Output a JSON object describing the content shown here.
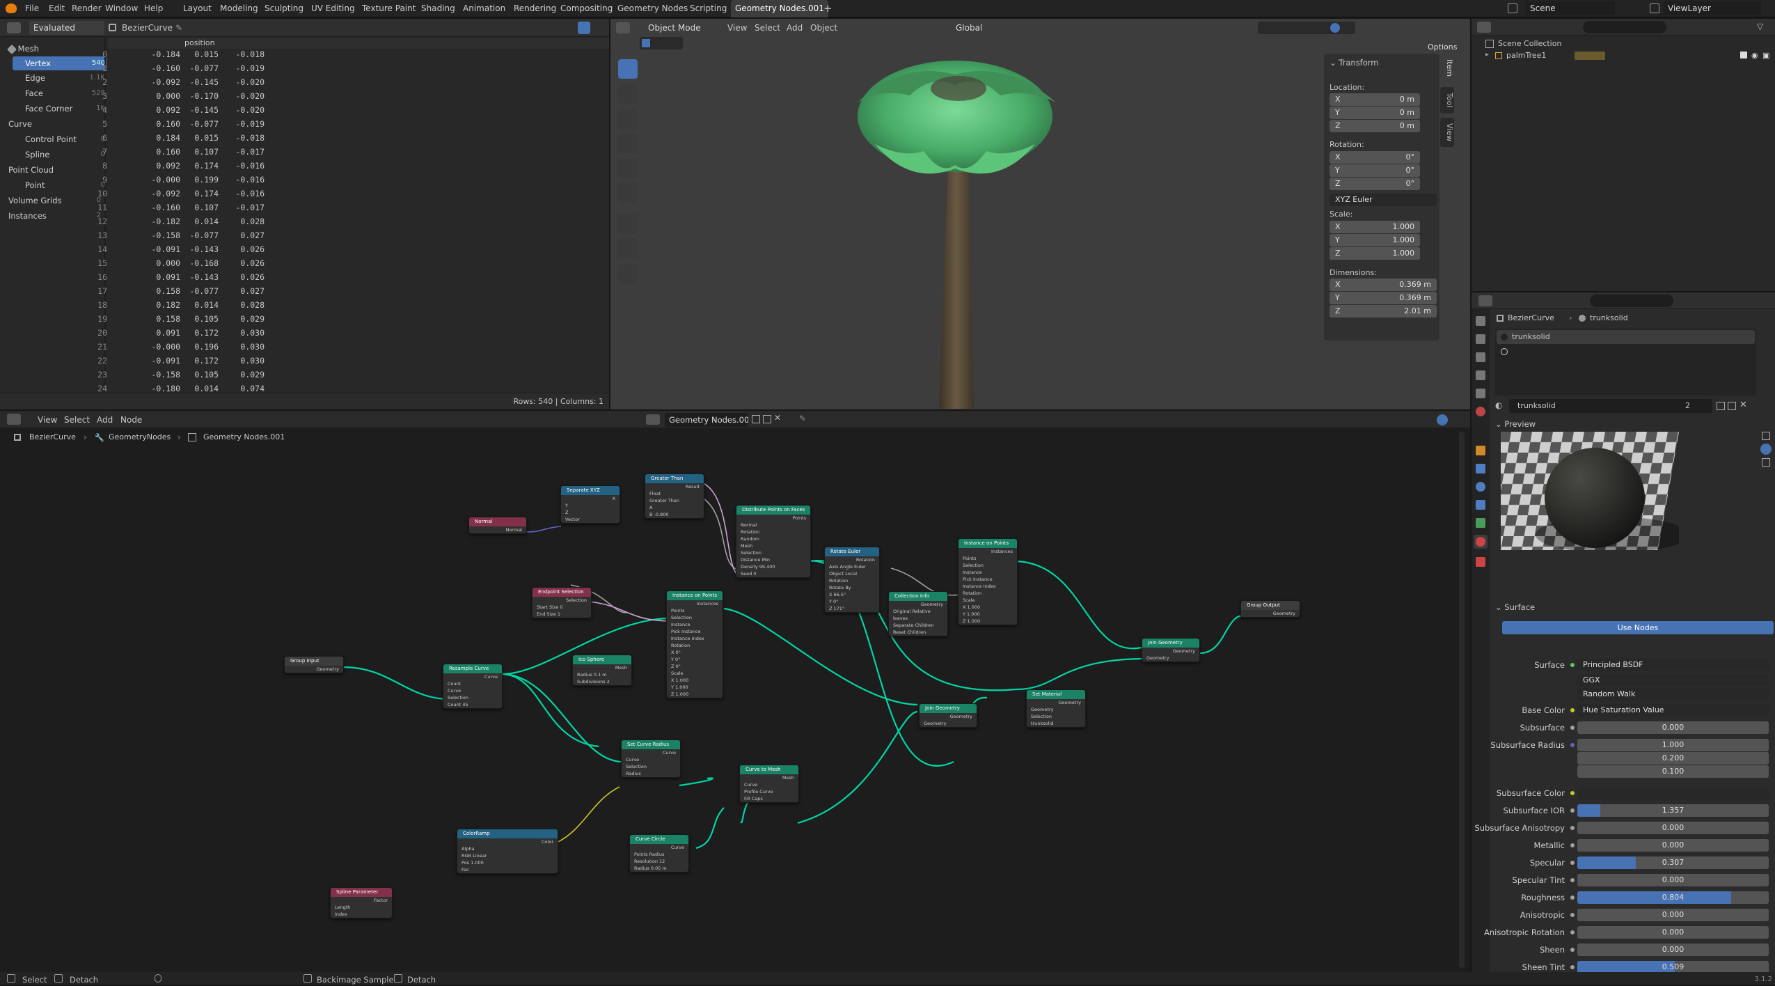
{
  "topbar": {
    "menus": [
      "File",
      "Edit",
      "Render",
      "Window",
      "Help"
    ],
    "workspaces": [
      "Layout",
      "Modeling",
      "Sculpting",
      "UV Editing",
      "Texture Paint",
      "Shading",
      "Animation",
      "Rendering",
      "Compositing",
      "Geometry Nodes",
      "Scripting",
      "Geometry Nodes.001"
    ],
    "scene": "Scene",
    "view_layer": "ViewLayer"
  },
  "spreadsheet": {
    "mode": "Evaluated",
    "object": "BezierCurve",
    "column": "position",
    "tree": [
      {
        "label": "Mesh",
        "count": ""
      },
      {
        "label": "Vertex",
        "count": "540"
      },
      {
        "label": "Edge",
        "count": "1.1K"
      },
      {
        "label": "Face",
        "count": "528"
      },
      {
        "label": "Face Corner",
        "count": "1K"
      },
      {
        "label": "Curve",
        "count": ""
      },
      {
        "label": "Control Point",
        "count": "0"
      },
      {
        "label": "Spline",
        "count": "0"
      },
      {
        "label": "Point Cloud",
        "count": ""
      },
      {
        "label": "Point",
        "count": "0"
      },
      {
        "label": "Volume Grids",
        "count": "0"
      },
      {
        "label": "Instances",
        "count": "2"
      }
    ],
    "rows": [
      [
        "0",
        "-0.184",
        "0.015",
        "-0.018"
      ],
      [
        "1",
        "-0.160",
        "-0.077",
        "-0.019"
      ],
      [
        "2",
        "-0.092",
        "-0.145",
        "-0.020"
      ],
      [
        "3",
        "0.000",
        "-0.170",
        "-0.020"
      ],
      [
        "4",
        "0.092",
        "-0.145",
        "-0.020"
      ],
      [
        "5",
        "0.160",
        "-0.077",
        "-0.019"
      ],
      [
        "6",
        "0.184",
        "0.015",
        "-0.018"
      ],
      [
        "7",
        "0.160",
        "0.107",
        "-0.017"
      ],
      [
        "8",
        "0.092",
        "0.174",
        "-0.016"
      ],
      [
        "9",
        "-0.000",
        "0.199",
        "-0.016"
      ],
      [
        "10",
        "-0.092",
        "0.174",
        "-0.016"
      ],
      [
        "11",
        "-0.160",
        "0.107",
        "-0.017"
      ],
      [
        "12",
        "-0.182",
        "0.014",
        "0.028"
      ],
      [
        "13",
        "-0.158",
        "-0.077",
        "0.027"
      ],
      [
        "14",
        "-0.091",
        "-0.143",
        "0.026"
      ],
      [
        "15",
        "0.000",
        "-0.168",
        "0.026"
      ],
      [
        "16",
        "0.091",
        "-0.143",
        "0.026"
      ],
      [
        "17",
        "0.158",
        "-0.077",
        "0.027"
      ],
      [
        "18",
        "0.182",
        "0.014",
        "0.028"
      ],
      [
        "19",
        "0.158",
        "0.105",
        "0.029"
      ],
      [
        "20",
        "0.091",
        "0.172",
        "0.030"
      ],
      [
        "21",
        "-0.000",
        "0.196",
        "0.030"
      ],
      [
        "22",
        "-0.091",
        "0.172",
        "0.030"
      ],
      [
        "23",
        "-0.158",
        "0.105",
        "0.029"
      ],
      [
        "24",
        "-0.180",
        "0.014",
        "0.074"
      ]
    ],
    "footer": "Rows: 540   |   Columns: 1"
  },
  "viewport": {
    "mode": "Object Mode",
    "menus": [
      "View",
      "Select",
      "Add",
      "Object"
    ],
    "orientation": "Global",
    "options": "Options",
    "tabs": [
      "Item",
      "Tool",
      "View"
    ],
    "transform": {
      "title": "Transform",
      "location_label": "Location:",
      "rotation_label": "Rotation:",
      "scale_label": "Scale:",
      "dimensions_label": "Dimensions:",
      "rot_mode": "XYZ Euler",
      "location": [
        [
          "X",
          "0 m"
        ],
        [
          "Y",
          "0 m"
        ],
        [
          "Z",
          "0 m"
        ]
      ],
      "rotation": [
        [
          "X",
          "0°"
        ],
        [
          "Y",
          "0°"
        ],
        [
          "Z",
          "0°"
        ]
      ],
      "scale": [
        [
          "X",
          "1.000"
        ],
        [
          "Y",
          "1.000"
        ],
        [
          "Z",
          "1.000"
        ]
      ],
      "dimensions": [
        [
          "X",
          "0.369 m"
        ],
        [
          "Y",
          "0.369 m"
        ],
        [
          "Z",
          "2.01 m"
        ]
      ]
    }
  },
  "outliner": {
    "collection": "Scene Collection",
    "object": "palmTree1"
  },
  "node_editor": {
    "menus": [
      "View",
      "Select",
      "Add",
      "Node"
    ],
    "tree_name": "Geometry Nodes.001",
    "breadcrumb": [
      "BezierCurve",
      "GeometryNodes",
      "Geometry Nodes.001"
    ],
    "nodes": [
      {
        "title": "Group Input",
        "rows": [
          "Geometry"
        ]
      },
      {
        "title": "Resample Curve",
        "rows": [
          "Curve",
          "Count",
          "Curve",
          "Selection",
          "Count  45"
        ]
      },
      {
        "title": "Normal",
        "rows": [
          "Normal"
        ]
      },
      {
        "title": "Separate XYZ",
        "rows": [
          "X",
          "Y",
          "Z",
          "Vector"
        ]
      },
      {
        "title": "Greater Than",
        "rows": [
          "Result",
          "Float",
          "Greater Than",
          "A",
          "B  -0.800"
        ]
      },
      {
        "title": "Endpoint Selection",
        "rows": [
          "Selection",
          "Start Size  0",
          "End Size  1"
        ]
      },
      {
        "title": "Ico Sphere",
        "rows": [
          "Mesh",
          "Radius  0.1 m",
          "Subdivisions  2"
        ]
      },
      {
        "title": "Instance on Points",
        "rows": [
          "Instances",
          "Points",
          "Selection",
          "Instance",
          "Pick Instance",
          "Instance Index",
          "Rotation",
          "X 0°",
          "Y 0°",
          "Z 0°",
          "Scale",
          "X 1.000",
          "Y 1.000",
          "Z 1.000"
        ]
      },
      {
        "title": "Distribute Points on Faces",
        "rows": [
          "Points",
          "Normal",
          "Rotation",
          "Random",
          "Mesh",
          "Selection",
          "Distance Min",
          "Density  99.400",
          "Seed  0"
        ]
      },
      {
        "title": "Rotate Euler",
        "rows": [
          "Rotation",
          "Axis Angle   Euler",
          "Object   Local",
          "Rotation",
          "Rotate By",
          "X 66.5°",
          "Y 0°",
          "Z 171°"
        ]
      },
      {
        "title": "Collection Info",
        "rows": [
          "Geometry",
          "Original   Relative",
          "leaves",
          "Separate Children",
          "Reset Children"
        ]
      },
      {
        "title": "Instance on Points",
        "rows": [
          "Instances",
          "Points",
          "Selection",
          "Instance",
          "Pick Instance",
          "Instance Index",
          "Rotation",
          "Scale",
          "X 1.000",
          "Y 1.000",
          "Z 1.000"
        ]
      },
      {
        "title": "Group Output",
        "rows": [
          "Geometry"
        ]
      },
      {
        "title": "Join Geometry",
        "rows": [
          "Geometry",
          "Geometry"
        ]
      },
      {
        "title": "Set Material",
        "rows": [
          "Geometry",
          "Geometry",
          "Selection",
          "trunksolid"
        ]
      },
      {
        "title": "Join Geometry",
        "rows": [
          "Geometry",
          "Geometry"
        ]
      },
      {
        "title": "Set Curve Radius",
        "rows": [
          "Curve",
          "Curve",
          "Selection",
          "Radius"
        ]
      },
      {
        "title": "Curve to Mesh",
        "rows": [
          "Mesh",
          "Curve",
          "Profile Curve",
          "Fill Caps"
        ]
      },
      {
        "title": "ColorRamp",
        "rows": [
          "Color",
          "Alpha",
          "RGB   Linear",
          "Pos  1.000",
          "Fac"
        ]
      },
      {
        "title": "Curve Circle",
        "rows": [
          "Curve",
          "Points   Radius",
          "Resolution  12",
          "Radius  0.05 m"
        ]
      },
      {
        "title": "Spline Parameter",
        "rows": [
          "Factor",
          "Length",
          "Index"
        ]
      }
    ]
  },
  "properties": {
    "breadcrumb": [
      "BezierCurve",
      "trunksolid"
    ],
    "slot": "trunksolid",
    "material": "trunksolid",
    "users": "2",
    "preview_label": "Preview",
    "surface_section": "Surface",
    "use_nodes": "Use Nodes",
    "surface_label": "Surface",
    "surface_value": "Principled BSDF",
    "distribution": "GGX",
    "sss_method": "Random Walk",
    "rows": [
      {
        "label": "Base Color",
        "value": "Hue Saturation Value",
        "fill": 0
      },
      {
        "label": "Subsurface",
        "value": "0.000",
        "fill": 0
      },
      {
        "label": "Subsurface Radius",
        "value": "1.000",
        "fill": 0
      },
      {
        "label": "",
        "value": "0.200",
        "fill": 0
      },
      {
        "label": "",
        "value": "0.100",
        "fill": 0
      },
      {
        "label": "Subsurface Color",
        "value": "",
        "fill": 0
      },
      {
        "label": "Subsurface IOR",
        "value": "1.357",
        "fill": 0.12
      },
      {
        "label": "Subsurface Anisotropy",
        "value": "0.000",
        "fill": 0
      },
      {
        "label": "Metallic",
        "value": "0.000",
        "fill": 0
      },
      {
        "label": "Specular",
        "value": "0.307",
        "fill": 0.307
      },
      {
        "label": "Specular Tint",
        "value": "0.000",
        "fill": 0
      },
      {
        "label": "Roughness",
        "value": "0.804",
        "fill": 0.804
      },
      {
        "label": "Anisotropic",
        "value": "0.000",
        "fill": 0
      },
      {
        "label": "Anisotropic Rotation",
        "value": "0.000",
        "fill": 0
      },
      {
        "label": "Sheen",
        "value": "0.000",
        "fill": 0
      },
      {
        "label": "Sheen Tint",
        "value": "0.509",
        "fill": 0.509
      }
    ]
  },
  "statusbar": {
    "left": [
      "Select",
      "Detach"
    ],
    "mid": [
      "Backimage Sample",
      "Detach"
    ],
    "version": "3.1.2"
  },
  "colors": {
    "accent": "#4772b3",
    "geometry_link": "#00d6a3",
    "float_link": "#a1a1a1",
    "bool_link": "#cca6d6",
    "node_geo_header": "#1a8265",
    "node_input_header": "#83314a",
    "node_converter_header": "#246283"
  }
}
